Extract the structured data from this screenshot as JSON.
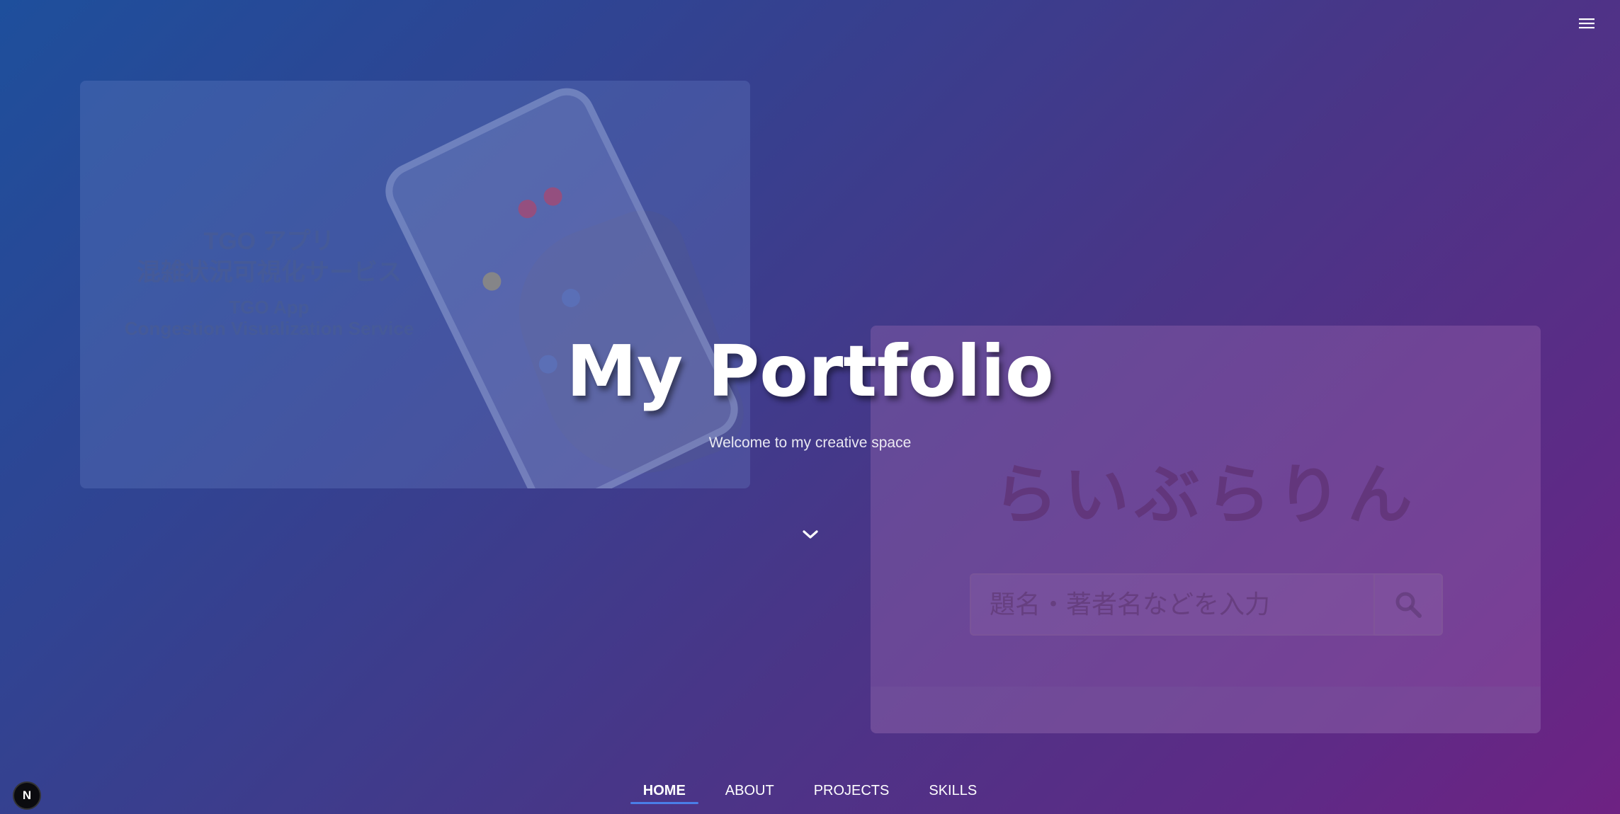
{
  "menu": {
    "icon": "hamburger-menu-icon"
  },
  "cards": [
    {
      "title_jp": "TGO アプリ",
      "subtitle_jp": "混雑状況可視化サービス",
      "title_en": "TGO App",
      "subtitle_en": "Congestion Visualization Service"
    },
    {
      "title": "らいぶらりん",
      "search_placeholder": "題名・著者名などを入力",
      "search_icon": "search-icon"
    }
  ],
  "hero": {
    "title": "My Portfolio",
    "subtitle": "Welcome to my creative space"
  },
  "scroll_icon": "chevron-down-icon",
  "nav": {
    "items": [
      {
        "label": "HOME",
        "active": true
      },
      {
        "label": "ABOUT",
        "active": false
      },
      {
        "label": "PROJECTS",
        "active": false
      },
      {
        "label": "SKILLS",
        "active": false
      }
    ]
  },
  "badge": {
    "label": "N"
  },
  "colors": {
    "gradient_start": "#1e4f9c",
    "gradient_end": "#6e2283",
    "nav_active_underline": "#4a7ee8"
  }
}
